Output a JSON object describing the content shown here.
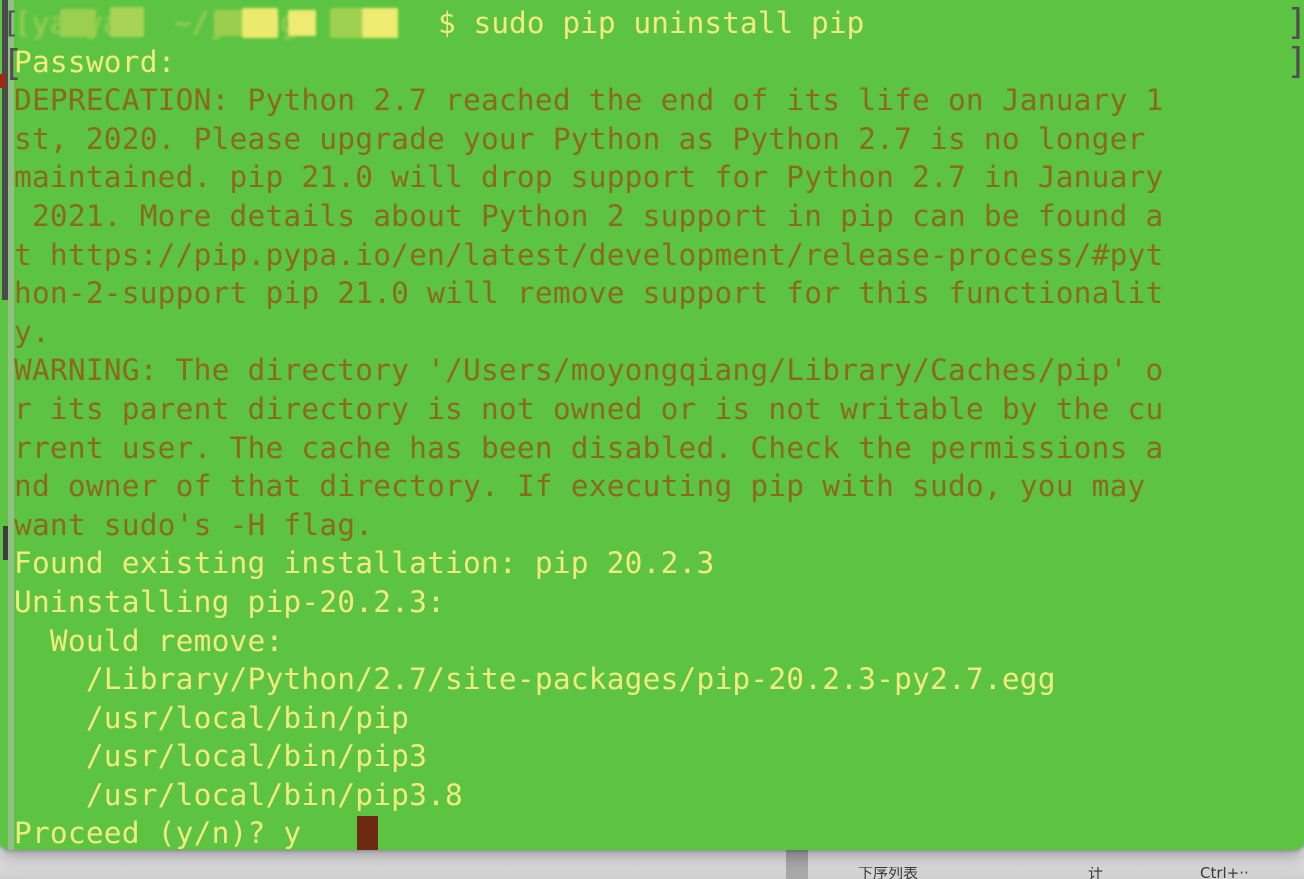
{
  "window": {
    "kind": "terminal",
    "background_color": "#5cc442",
    "text_color_bright": "#f2ec7e",
    "text_color_dim": "#8a6a1c",
    "cursor_color": "#6e2a10"
  },
  "terminal": {
    "prompt": {
      "redacted": true,
      "redacted_text": "[yanya`  ~/jiang",
      "visible_tail": "$ sudo pip uninstall pip",
      "edge_bracket": "["
    },
    "password_prompt": {
      "bracket": "[",
      "label": "Password:"
    },
    "right_edge_artifacts": [
      "]",
      "]"
    ],
    "lines": [
      {
        "text": "DEPRECATION: Python 2.7 reached the end of its life on January 1",
        "style": "dim"
      },
      {
        "text": "st, 2020. Please upgrade your Python as Python 2.7 is no longer",
        "style": "dim"
      },
      {
        "text": "maintained. pip 21.0 will drop support for Python 2.7 in January",
        "style": "dim"
      },
      {
        "text": " 2021. More details about Python 2 support in pip can be found a",
        "style": "dim"
      },
      {
        "text": "t https://pip.pypa.io/en/latest/development/release-process/#pyt",
        "style": "dim"
      },
      {
        "text": "hon-2-support pip 21.0 will remove support for this functionalit",
        "style": "dim"
      },
      {
        "text": "y.",
        "style": "dim"
      },
      {
        "text": "WARNING: The directory '/Users/moyongqiang/Library/Caches/pip' o",
        "style": "dim"
      },
      {
        "text": "r its parent directory is not owned or is not writable by the cu",
        "style": "dim"
      },
      {
        "text": "rrent user. The cache has been disabled. Check the permissions a",
        "style": "dim"
      },
      {
        "text": "nd owner of that directory. If executing pip with sudo, you may",
        "style": "dim"
      },
      {
        "text": "want sudo's -H flag.",
        "style": "dim"
      },
      {
        "text": "Found existing installation: pip 20.2.3",
        "style": "bright"
      },
      {
        "text": "Uninstalling pip-20.2.3:",
        "style": "bright"
      },
      {
        "text": "  Would remove:",
        "style": "bright"
      },
      {
        "text": "    /Library/Python/2.7/site-packages/pip-20.2.3-py2.7.egg",
        "style": "bright"
      },
      {
        "text": "    /usr/local/bin/pip",
        "style": "bright"
      },
      {
        "text": "    /usr/local/bin/pip3",
        "style": "bright"
      },
      {
        "text": "    /usr/local/bin/pip3.8",
        "style": "bright"
      }
    ],
    "final_prompt": {
      "text": "Proceed (y/n)? y",
      "style": "bright",
      "cursor": true
    }
  },
  "background_window": {
    "menu_label": "下序列表",
    "menu_icon": "计",
    "menu_accel": "Ctrl+··"
  }
}
